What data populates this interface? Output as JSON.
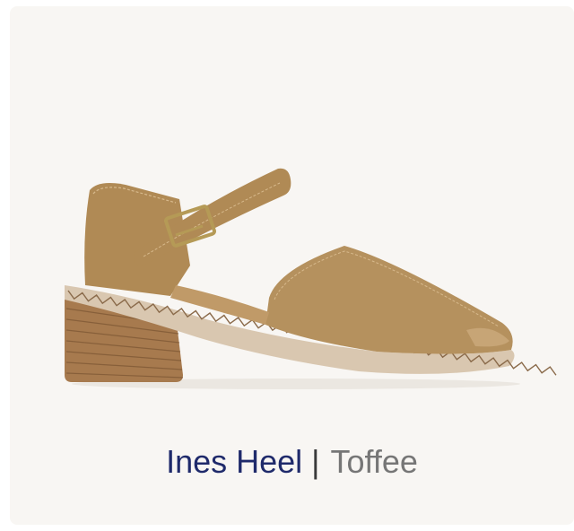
{
  "product": {
    "name": "Ines Heel",
    "separator": "|",
    "color_name": "Toffee",
    "image_icon": "sandal-product-image"
  },
  "colors": {
    "card_background": "#f8f6f3",
    "name_text": "#1f2a6b",
    "color_text": "#767676",
    "leather": "#b08a55"
  }
}
